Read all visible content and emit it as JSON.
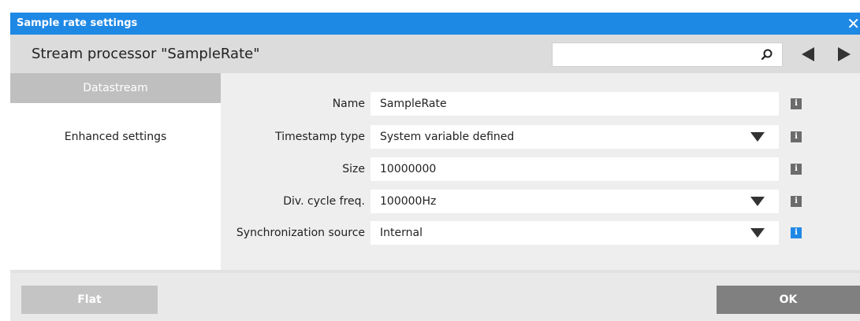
{
  "window": {
    "title": "Sample rate settings",
    "close_glyph": "✕"
  },
  "header": {
    "title": "Stream processor \"SampleRate\"",
    "search": {
      "value": "",
      "placeholder": ""
    },
    "icons": [
      "search-icon",
      "arrow-left-icon",
      "arrow-right-icon"
    ]
  },
  "sidebar": {
    "items": [
      {
        "label": "Datastream",
        "active": true
      },
      {
        "label": "Enhanced settings",
        "active": false
      }
    ]
  },
  "form": {
    "rows": [
      {
        "label": "Name",
        "value": "SampleRate",
        "type": "text",
        "info_color": "#6b6b6b"
      },
      {
        "label": "Timestamp type",
        "value": "System variable defined",
        "type": "dropdown",
        "info_color": "#6b6b6b"
      },
      {
        "label": "Size",
        "value": "10000000",
        "type": "text",
        "info_color": "#6b6b6b"
      },
      {
        "label": "Div. cycle freq.",
        "value": "100000Hz",
        "type": "dropdown",
        "info_color": "#6b6b6b"
      },
      {
        "label": "Synchronization source",
        "value": "Internal",
        "type": "dropdown",
        "info_color": "#1e88e5"
      }
    ],
    "info_glyph": "i"
  },
  "footer": {
    "flat_label": "Flat",
    "ok_label": "OK"
  },
  "colors": {
    "accent": "#1e88e5",
    "header_bg": "#dcdcdc",
    "content_bg": "#eeeeee",
    "active_item": "#bfbfbf",
    "ok_button": "#808080",
    "flat_button": "#c4c4c4"
  }
}
